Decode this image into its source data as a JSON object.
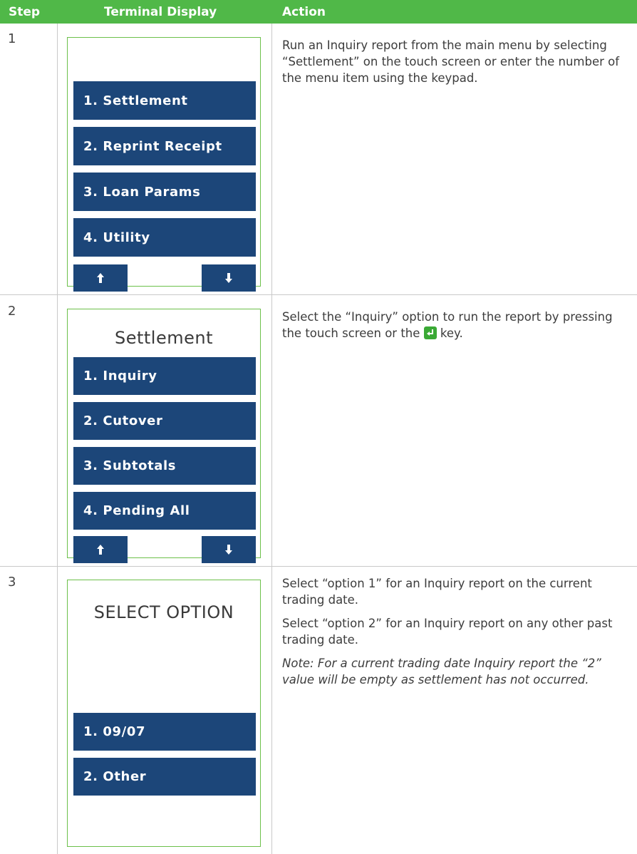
{
  "headers": {
    "step": "Step",
    "display": "Terminal Display",
    "action": "Action"
  },
  "steps": [
    {
      "number": "1",
      "title": "",
      "buttons": [
        "1. Settlement",
        "2. Reprint Receipt",
        "3. Loan Params",
        "4. Utility"
      ],
      "action": [
        "Run an Inquiry report from the main menu by selecting “Settlement” on the touch screen or enter the number of the menu item using the keypad."
      ]
    },
    {
      "number": "2",
      "title": "Settlement",
      "buttons": [
        "1. Inquiry",
        "2. Cutover",
        "3. Subtotals",
        "4. Pending All"
      ],
      "action_pre": "Select the “Inquiry” option to run the report by pressing the touch screen or the",
      "action_post": " key."
    },
    {
      "number": "3",
      "title": "SELECT OPTION",
      "buttons": [
        "1. 09/07",
        "2. Other"
      ],
      "action": [
        "Select “option 1” for an Inquiry report on the current trading date.",
        "Select “option 2” for an Inquiry report on any other past trading date."
      ],
      "note": "Note: For a current trading date Inquiry report the “2” value will be empty as settlement has not occurred."
    }
  ],
  "icons": {
    "scroll_up": "arrow-up-icon",
    "scroll_down": "arrow-down-icon",
    "enter_key": "enter-key-icon"
  },
  "colors": {
    "header": "#50b848",
    "button": "#1c4679",
    "device_border": "#6cc04a"
  }
}
